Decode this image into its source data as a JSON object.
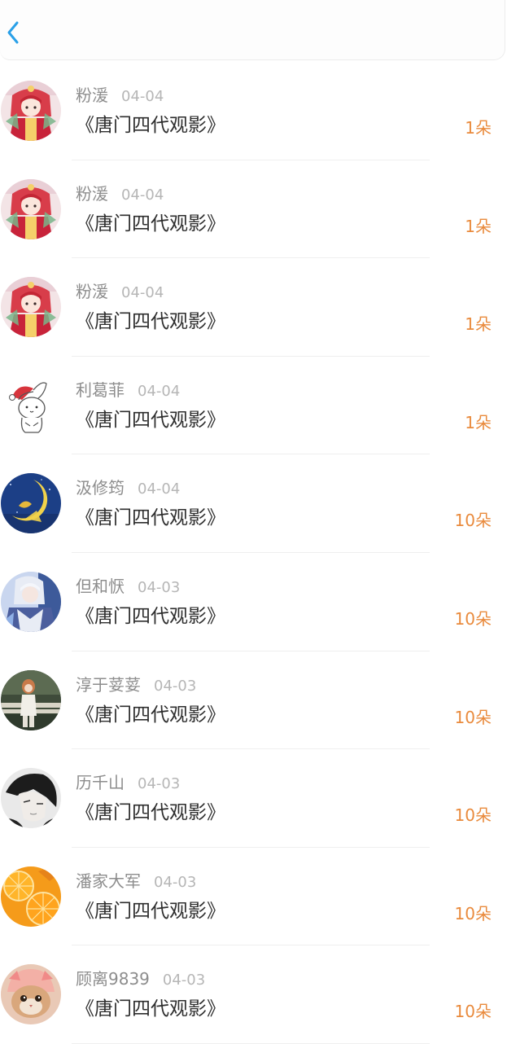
{
  "header": {
    "back_icon": "chevron-left-icon",
    "accent_color": "#2aa0e8"
  },
  "entries": [
    {
      "name": "粉湲",
      "date": "04-04",
      "title": "《唐门四代观影》",
      "count": "1朵",
      "avatar": "anime-girl-red"
    },
    {
      "name": "粉湲",
      "date": "04-04",
      "title": "《唐门四代观影》",
      "count": "1朵",
      "avatar": "anime-girl-red"
    },
    {
      "name": "粉湲",
      "date": "04-04",
      "title": "《唐门四代观影》",
      "count": "1朵",
      "avatar": "anime-girl-red"
    },
    {
      "name": "利葛菲",
      "date": "04-04",
      "title": "《唐门四代观影》",
      "count": "1朵",
      "avatar": "bunny-santa-hat"
    },
    {
      "name": "汲修筠",
      "date": "04-04",
      "title": "《唐门四代观影》",
      "count": "10朵",
      "avatar": "crescent-moon-night"
    },
    {
      "name": "但和恹",
      "date": "04-03",
      "title": "《唐门四代观影》",
      "count": "10朵",
      "avatar": "anime-knight-blue"
    },
    {
      "name": "淳于荽荽",
      "date": "04-03",
      "title": "《唐门四代观影》",
      "count": "10朵",
      "avatar": "girl-on-bench"
    },
    {
      "name": "历千山",
      "date": "04-03",
      "title": "《唐门四代观影》",
      "count": "10朵",
      "avatar": "dark-haired-boy"
    },
    {
      "name": "潘家大军",
      "date": "04-03",
      "title": "《唐门四代观影》",
      "count": "10朵",
      "avatar": "orange-slices"
    },
    {
      "name": "顾离9839",
      "date": "04-03",
      "title": "《唐门四代观影》",
      "count": "10朵",
      "avatar": "cat-in-hat"
    }
  ],
  "colors": {
    "name": "#8d8d8d",
    "date": "#b6b6b6",
    "title": "#2e2e2e",
    "count": "#e98a3c"
  }
}
